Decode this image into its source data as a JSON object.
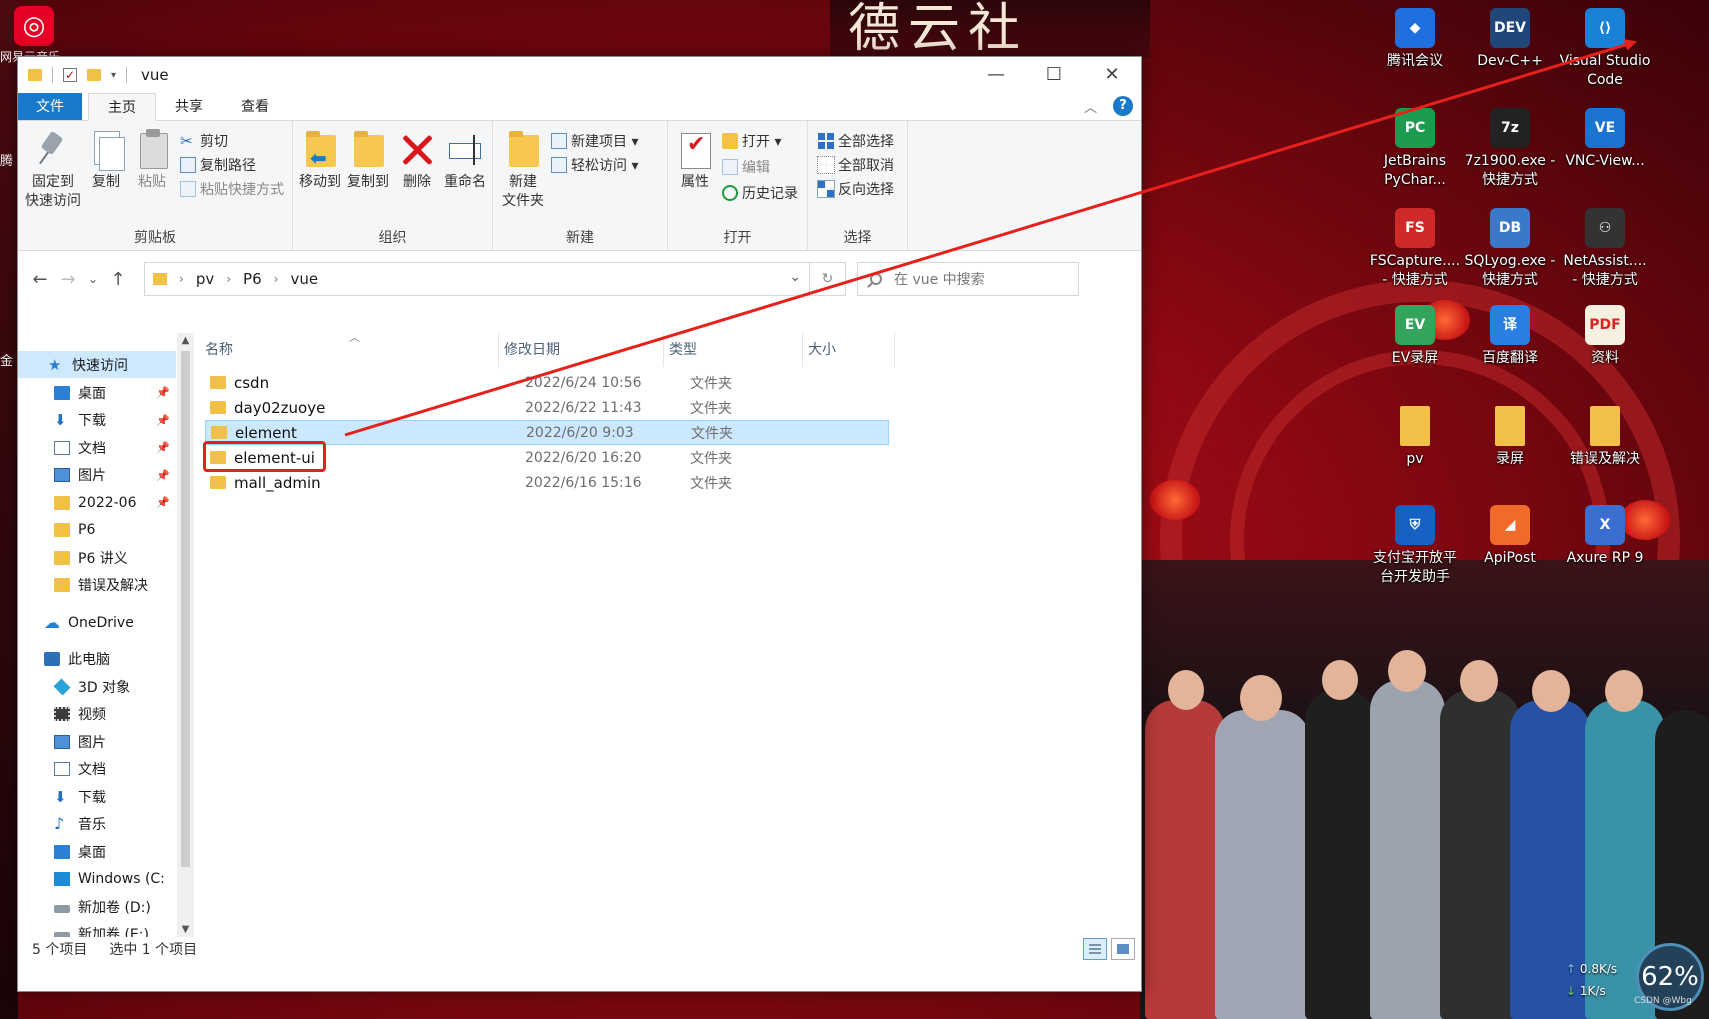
{
  "desktop": {
    "left_app_label": "网易云音乐",
    "left_edge_labels": [
      "腾",
      "金"
    ],
    "stage_title": "德云社",
    "icons": [
      {
        "label": "腾讯会议",
        "name": "tencent-meeting-icon",
        "color": "#1f6fe0",
        "glyph": "◆"
      },
      {
        "label": "Dev-C++",
        "name": "dev-cpp-icon",
        "color": "#20467a",
        "glyph": "DEV"
      },
      {
        "label": "Visual Studio Code",
        "name": "vscode-icon",
        "color": "#1a82d6",
        "glyph": "⟨⟩"
      },
      {
        "label": "JetBrains PyChar...",
        "name": "pycharm-icon",
        "color": "#1d9c4f",
        "glyph": "PC"
      },
      {
        "label": "7z1900.exe - 快捷方式",
        "name": "7zip-icon",
        "color": "#222222",
        "glyph": "7z"
      },
      {
        "label": "VNC-View...",
        "name": "vnc-viewer-icon",
        "color": "#1b73d2",
        "glyph": "VE"
      },
      {
        "label": "FSCapture.... - 快捷方式",
        "name": "fscapture-icon",
        "color": "#cf2a2a",
        "glyph": "FS"
      },
      {
        "label": "SQLyog.exe - 快捷方式",
        "name": "sqlyog-icon",
        "color": "#3a78c8",
        "glyph": "DB"
      },
      {
        "label": "NetAssist.... - 快捷方式",
        "name": "netassist-icon",
        "color": "#333333",
        "glyph": "⚇"
      },
      {
        "label": "EV录屏",
        "name": "ev-recorder-icon",
        "color": "#34a35c",
        "glyph": "EV"
      },
      {
        "label": "百度翻译",
        "name": "baidu-translate-icon",
        "color": "#2a7de1",
        "glyph": "译"
      },
      {
        "label": "资料",
        "name": "materials-file-icon",
        "color": "#f6f0e0",
        "glyph": "PDF"
      },
      {
        "label": "pv",
        "name": "pv-folder-icon",
        "color": "#f1c048",
        "glyph": ""
      },
      {
        "label": "录屏",
        "name": "record-folder-icon",
        "color": "#f1c048",
        "glyph": ""
      },
      {
        "label": "错误及解决",
        "name": "errors-folder-icon",
        "color": "#f1c048",
        "glyph": ""
      },
      {
        "label": "支付宝开放平台开发助手",
        "name": "alipay-dev-icon",
        "color": "#1761c2",
        "glyph": "⛨"
      },
      {
        "label": "ApiPost",
        "name": "apipost-icon",
        "color": "#f26a2a",
        "glyph": "◢"
      },
      {
        "label": "Axure RP 9",
        "name": "axure-icon",
        "color": "#3a6fd1",
        "glyph": "X"
      }
    ],
    "netspeed": {
      "up": "0.8K/s",
      "down": "1K/s"
    },
    "gauge": "62%",
    "watermark": "CSDN @Wbg"
  },
  "explorer": {
    "title": "vue",
    "window_buttons": [
      "—",
      "☐",
      "✕"
    ],
    "tabs": [
      {
        "label": "文件"
      },
      {
        "label": "主页"
      },
      {
        "label": "共享"
      },
      {
        "label": "查看"
      }
    ],
    "ribbon": {
      "clipboard": {
        "label": "剪贴板",
        "pin_l1": "固定到",
        "pin_l2": "快速访问",
        "copy": "复制",
        "paste": "粘贴",
        "cut": "剪切",
        "copy_path": "复制路径",
        "paste_shortcut": "粘贴快捷方式"
      },
      "organize": {
        "label": "组织",
        "move_to": "移动到",
        "copy_to": "复制到",
        "delete": "删除",
        "rename": "重命名"
      },
      "new": {
        "label": "新建",
        "new_folder_l1": "新建",
        "new_folder_l2": "文件夹",
        "new_item": "新建项目 ▾",
        "easy_access": "轻松访问 ▾"
      },
      "open": {
        "label": "打开",
        "properties": "属性",
        "open": "打开 ▾",
        "edit": "编辑",
        "history": "历史记录"
      },
      "select": {
        "label": "选择",
        "select_all": "全部选择",
        "select_none": "全部取消",
        "invert": "反向选择"
      }
    },
    "address": {
      "crumbs": [
        "pv",
        "P6",
        "vue"
      ],
      "search_placeholder": "在 vue 中搜索"
    },
    "nav": {
      "quick_access": "快速访问",
      "qa_items": [
        "桌面",
        "下载",
        "文档",
        "图片",
        "2022-06",
        "P6",
        "P6 讲义",
        "错误及解决"
      ],
      "onedrive": "OneDrive",
      "this_pc": "此电脑",
      "pc_items": [
        "3D 对象",
        "视频",
        "图片",
        "文档",
        "下载",
        "音乐",
        "桌面",
        "Windows (C:",
        "新加卷 (D:)",
        "新加卷 (E:)"
      ]
    },
    "columns": {
      "name": "名称",
      "date": "修改日期",
      "type": "类型",
      "size": "大小"
    },
    "files": [
      {
        "name": "csdn",
        "date": "2022/6/24 10:56",
        "type": "文件夹"
      },
      {
        "name": "day02zuoye",
        "date": "2022/6/22 11:43",
        "type": "文件夹"
      },
      {
        "name": "element",
        "date": "2022/6/20 9:03",
        "type": "文件夹"
      },
      {
        "name": "element-ui",
        "date": "2022/6/20 16:20",
        "type": "文件夹"
      },
      {
        "name": "mall_admin",
        "date": "2022/6/16 15:16",
        "type": "文件夹"
      }
    ],
    "status": {
      "count": "5 个项目",
      "selected": "选中 1 个项目"
    }
  },
  "annotation": {
    "color": "#e8201c"
  }
}
